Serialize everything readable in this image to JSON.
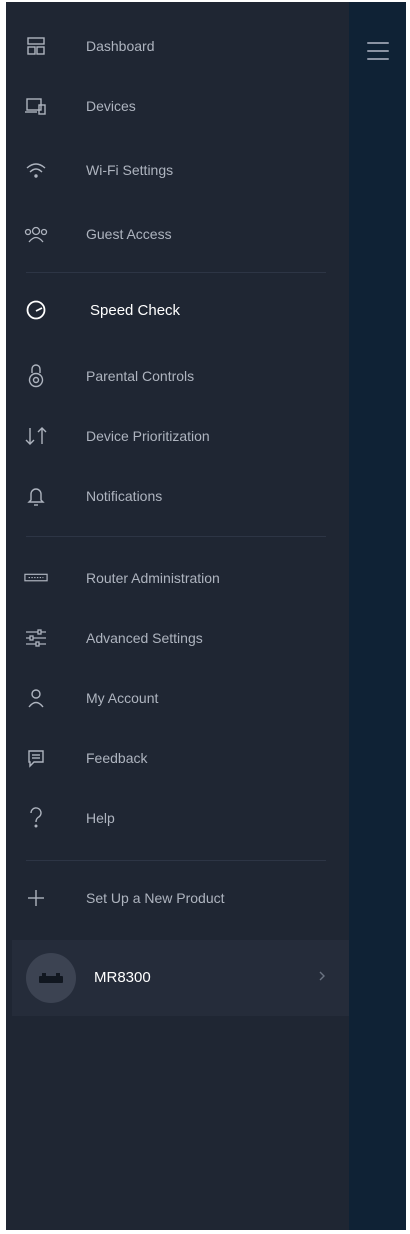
{
  "menu": {
    "toggle": "hamburger-icon",
    "items": [
      {
        "id": "dashboard",
        "label": "Dashboard",
        "icon": "dashboard-icon"
      },
      {
        "id": "devices",
        "label": "Devices",
        "icon": "devices-icon"
      },
      {
        "id": "wifi-settings",
        "label": "Wi-Fi Settings",
        "icon": "wifi-icon"
      },
      {
        "id": "guest-access",
        "label": "Guest Access",
        "icon": "guest-icon"
      },
      {
        "id": "speed-check",
        "label": "Speed Check",
        "icon": "speedometer-icon",
        "active": true
      },
      {
        "id": "parental-controls",
        "label": "Parental Controls",
        "icon": "lock-icon"
      },
      {
        "id": "device-prioritization",
        "label": "Device Prioritization",
        "icon": "arrows-icon"
      },
      {
        "id": "notifications",
        "label": "Notifications",
        "icon": "bell-icon"
      },
      {
        "id": "router-administration",
        "label": "Router Administration",
        "icon": "router-icon"
      },
      {
        "id": "advanced-settings",
        "label": "Advanced Settings",
        "icon": "sliders-icon"
      },
      {
        "id": "my-account",
        "label": "My Account",
        "icon": "user-icon"
      },
      {
        "id": "feedback",
        "label": "Feedback",
        "icon": "chat-icon"
      },
      {
        "id": "help",
        "label": "Help",
        "icon": "question-icon"
      },
      {
        "id": "setup-new-product",
        "label": "Set Up a New Product",
        "icon": "plus-icon"
      }
    ]
  },
  "product": {
    "name": "MR8300",
    "icon": "router-device-icon",
    "chevron": "chevron-right-icon"
  },
  "colors": {
    "background": "#1f2633",
    "side_panel": "#0f2235",
    "active_text": "#ffffff",
    "inactive_text": "#aeb4bf"
  }
}
